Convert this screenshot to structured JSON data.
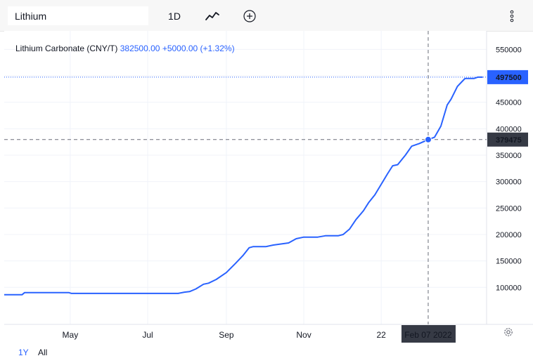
{
  "toolbar": {
    "search_value": "Lithium",
    "interval": "1D",
    "chart_type_icon": "line-chart-icon",
    "compare_icon": "plus-circle-icon",
    "more_icon": "vertical-dots-icon"
  },
  "legend": {
    "name": "Lithium Carbonate (CNY/T)",
    "price": "382500.00",
    "change": "+5000.00",
    "change_pct": "(+1.32%)"
  },
  "crosshair": {
    "date_label": "Feb 07 2022",
    "price_label": "379475"
  },
  "last_price_label": "497500",
  "range_buttons": {
    "one_year": "1Y",
    "all": "All"
  },
  "settings_icon": "gear-icon",
  "colors": {
    "line": "#2962ff",
    "accent": "#2962ff",
    "crosshair_label": "#363a45"
  },
  "chart_data": {
    "type": "line",
    "title": "Lithium Carbonate (CNY/T)",
    "xlabel": "",
    "ylabel": "",
    "ylim": [
      30000,
      585000
    ],
    "y_ticks": [
      100000,
      150000,
      200000,
      250000,
      300000,
      350000,
      400000,
      450000,
      500000,
      550000
    ],
    "y_tick_labels": [
      "100000",
      "150000",
      "200000",
      "250000",
      "300000",
      "350000",
      "400000",
      "450000",
      "500000",
      "550000"
    ],
    "x_tick_labels": [
      "May",
      "Jul",
      "Sep",
      "Nov",
      "22"
    ],
    "x_tick_dates": [
      "2021-05-01",
      "2021-07-01",
      "2021-09-01",
      "2021-11-01",
      "2022-01-01"
    ],
    "x_range": [
      "2021-03-10",
      "2022-03-25"
    ],
    "grid": true,
    "series": [
      {
        "name": "Lithium Carbonate (CNY/T)",
        "points": [
          [
            "2021-03-10",
            86000
          ],
          [
            "2021-03-24",
            86000
          ],
          [
            "2021-03-26",
            90000
          ],
          [
            "2021-04-30",
            90000
          ],
          [
            "2021-05-02",
            88500
          ],
          [
            "2021-07-25",
            88500
          ],
          [
            "2021-07-30",
            91000
          ],
          [
            "2021-08-03",
            92000
          ],
          [
            "2021-08-08",
            97000
          ],
          [
            "2021-08-14",
            106000
          ],
          [
            "2021-08-18",
            108000
          ],
          [
            "2021-08-24",
            115000
          ],
          [
            "2021-09-01",
            128000
          ],
          [
            "2021-09-08",
            145000
          ],
          [
            "2021-09-14",
            160000
          ],
          [
            "2021-09-19",
            175000
          ],
          [
            "2021-09-22",
            177000
          ],
          [
            "2021-10-02",
            177000
          ],
          [
            "2021-10-08",
            180000
          ],
          [
            "2021-10-20",
            184000
          ],
          [
            "2021-10-26",
            192000
          ],
          [
            "2021-11-01",
            195000
          ],
          [
            "2021-11-12",
            195000
          ],
          [
            "2021-11-18",
            197500
          ],
          [
            "2021-11-28",
            197500
          ],
          [
            "2021-12-02",
            200000
          ],
          [
            "2021-12-07",
            210000
          ],
          [
            "2021-12-12",
            228000
          ],
          [
            "2021-12-18",
            245000
          ],
          [
            "2021-12-22",
            260000
          ],
          [
            "2021-12-27",
            275000
          ],
          [
            "2022-01-01",
            295000
          ],
          [
            "2022-01-06",
            315000
          ],
          [
            "2022-01-10",
            330000
          ],
          [
            "2022-01-14",
            332000
          ],
          [
            "2022-01-20",
            350000
          ],
          [
            "2022-01-25",
            367000
          ],
          [
            "2022-01-31",
            372000
          ],
          [
            "2022-02-07",
            379475
          ],
          [
            "2022-02-12",
            384000
          ],
          [
            "2022-02-17",
            405000
          ],
          [
            "2022-02-22",
            445000
          ],
          [
            "2022-02-25",
            456000
          ],
          [
            "2022-03-02",
            480000
          ],
          [
            "2022-03-06",
            490000
          ],
          [
            "2022-03-08",
            495000
          ],
          [
            "2022-03-15",
            495000
          ],
          [
            "2022-03-18",
            497500
          ],
          [
            "2022-03-22",
            497500
          ]
        ]
      }
    ]
  }
}
